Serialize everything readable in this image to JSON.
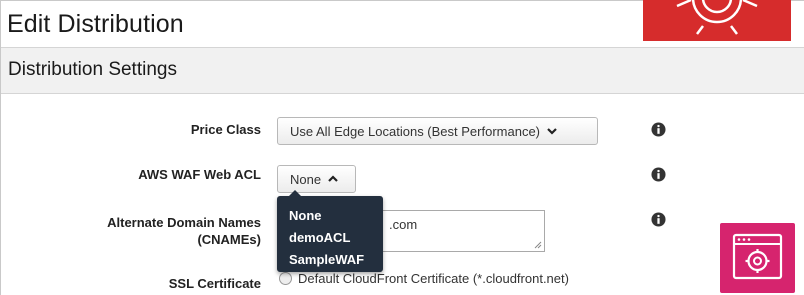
{
  "page": {
    "title": "Edit Distribution",
    "section_title": "Distribution Settings"
  },
  "form": {
    "price_class": {
      "label": "Price Class",
      "value": "Use All Edge Locations (Best Performance)",
      "icon": "chevron-down-icon"
    },
    "waf": {
      "label": "AWS WAF Web ACL",
      "value": "None",
      "icon": "chevron-up-icon",
      "options": [
        "None",
        "demoACL",
        "SampleWAF"
      ]
    },
    "cnames": {
      "label_line1": "Alternate Domain Names",
      "label_line2": "(CNAMEs)",
      "value": ".com"
    },
    "ssl": {
      "label": "SSL Certificate",
      "option_default": "Default CloudFront Certificate (*.cloudfront.net)"
    },
    "info_icon": "info-icon"
  },
  "badges": {
    "top": {
      "icon": "waf-shield-icon",
      "color": "#d62c2c"
    },
    "bottom": {
      "icon": "browser-settings-icon",
      "color": "#d6246e"
    }
  }
}
